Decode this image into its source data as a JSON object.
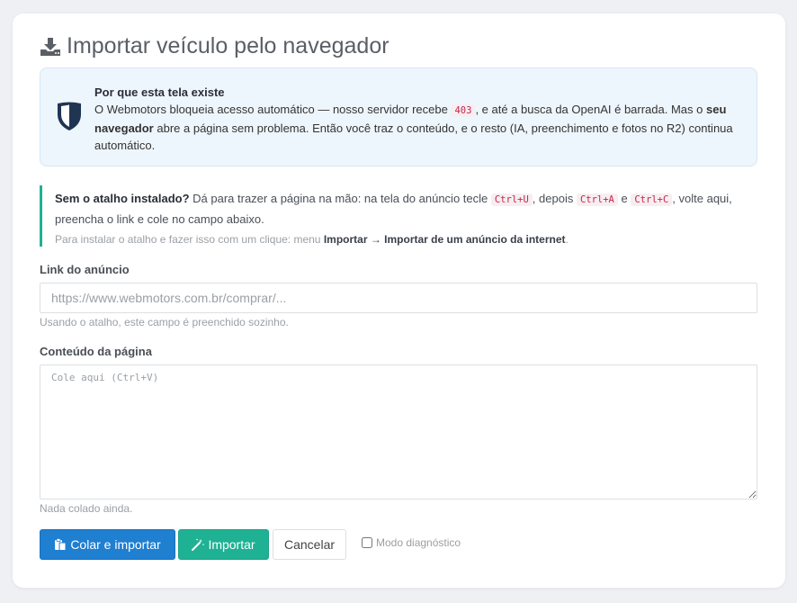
{
  "header": {
    "title": "Importar veículo pelo navegador",
    "icon": "download-icon"
  },
  "info": {
    "icon": "shield-icon",
    "heading": "Por que esta tela existe",
    "text_1": "O Webmotors bloqueia acesso automático — nosso servidor recebe ",
    "code_403": "403",
    "text_2": ", e até a busca da OpenAI é barrada. Mas o ",
    "bold_navigator": "seu navegador",
    "text_3": " abre a página sem problema. Então você traz o conteúdo, e o resto (IA, preenchimento e fotos no R2) continua automático."
  },
  "tip": {
    "bold": "Sem o atalho instalado?",
    "text_1": " Dá para trazer a página na mão: na tela do anúncio tecle ",
    "key_1": "Ctrl+U",
    "text_2": ", depois ",
    "key_2": "Ctrl+A",
    "text_3": " e ",
    "key_3": "Ctrl+C",
    "text_4": ", volte aqui, preencha o link e cole no campo abaixo.",
    "sub_text": "Para instalar o atalho e fazer isso com um clique: menu ",
    "sub_bold": "Importar → Importar de um anúncio da internet",
    "sub_end": "."
  },
  "link_field": {
    "label": "Link do anúncio",
    "placeholder": "https://www.webmotors.com.br/comprar/...",
    "hint": "Usando o atalho, este campo é preenchido sozinho."
  },
  "content_field": {
    "label": "Conteúdo da página",
    "placeholder": "Cole aqui (Ctrl+V)",
    "hint": "Nada colado ainda."
  },
  "actions": {
    "paste_import": "Colar e importar",
    "import": "Importar",
    "cancel": "Cancelar",
    "diagnostic": "Modo diagnóstico"
  },
  "colors": {
    "primary": "#1f7fd1",
    "success": "#1fb193",
    "accent_border": "#1fb193"
  }
}
